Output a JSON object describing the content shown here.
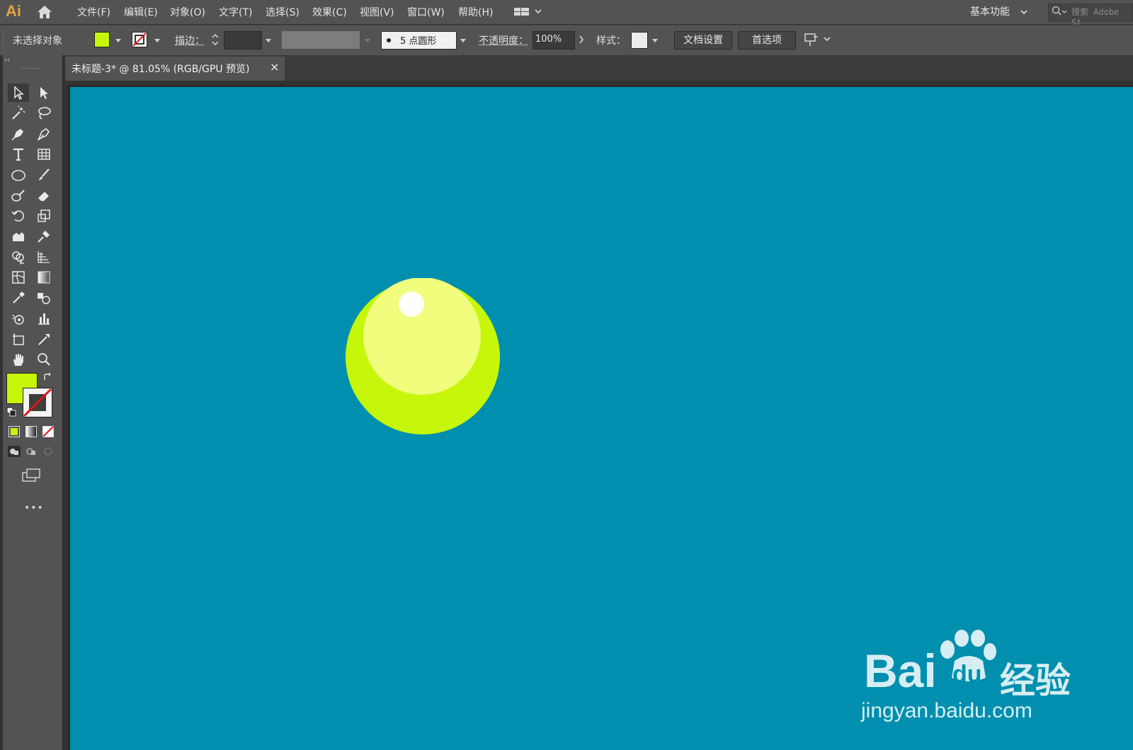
{
  "app": {
    "logo": "Ai"
  },
  "menu": [
    {
      "label": "文件(F)"
    },
    {
      "label": "编辑(E)"
    },
    {
      "label": "对象(O)"
    },
    {
      "label": "文字(T)"
    },
    {
      "label": "选择(S)"
    },
    {
      "label": "效果(C)"
    },
    {
      "label": "视图(V)"
    },
    {
      "label": "窗口(W)"
    },
    {
      "label": "帮助(H)"
    }
  ],
  "workspace": {
    "label": "基本功能"
  },
  "search": {
    "placeholder": "搜索 Adobe St"
  },
  "control_bar": {
    "selection_status": "未选择对象",
    "fill_color": "#c6f70a",
    "stroke_label": "描边：",
    "brush_label": "5 点圆形",
    "opacity_label": "不透明度：",
    "opacity_value": "100%",
    "style_label": "样式：",
    "doc_setup_button": "文档设置",
    "preferences_button": "首选项"
  },
  "document_tab": {
    "label": "未标题-3* @ 81.05% (RGB/GPU 预览)",
    "close": "×"
  },
  "toolbar": {
    "fill_color": "#c6f70a",
    "more": "•••"
  },
  "canvas": {
    "background": "#008fae",
    "ball_outer_color": "#c6f70a",
    "ball_inner_color": "#f1fd7c",
    "ball_highlight_color": "#ffffff"
  },
  "watermark": {
    "brand": "Bai",
    "brand_du": "du",
    "brand_cn": "经验",
    "url": "jingyan.baidu.com"
  }
}
